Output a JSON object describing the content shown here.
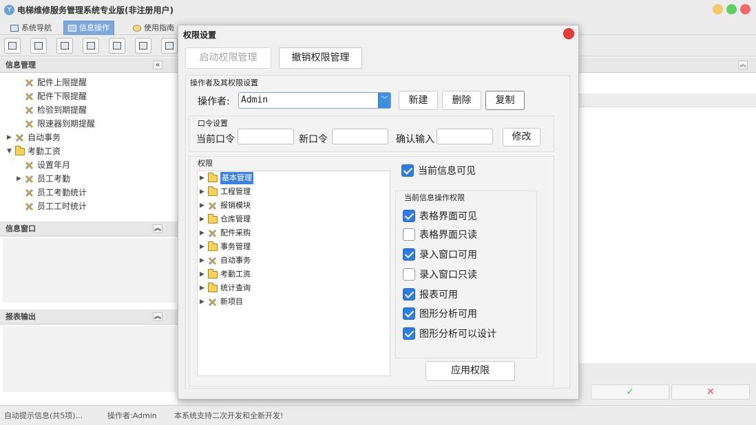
{
  "app": {
    "title": "电梯维修服务管理系统专业版(非注册用户)",
    "tabs": [
      {
        "label": "系统导航",
        "icon": "window-icon"
      },
      {
        "label": "信息操作",
        "icon": "grid-icon"
      },
      {
        "label": "使用指南",
        "icon": "help-icon"
      }
    ],
    "window_buttons": [
      "minimize",
      "maximize",
      "close"
    ]
  },
  "left": {
    "info_header": "信息管理",
    "nav": [
      {
        "label": "配件上限提醒",
        "icon": "tools-icon",
        "expandable": false
      },
      {
        "label": "配件下限提醒",
        "icon": "tools-icon",
        "expandable": false
      },
      {
        "label": "检验到期提醒",
        "icon": "tools-icon",
        "expandable": false
      },
      {
        "label": "限速器到期提醒",
        "icon": "tools-icon",
        "expandable": false
      },
      {
        "label": "自动事务",
        "icon": "tools-icon",
        "expandable": true,
        "expanded": false
      },
      {
        "label": "考勤工资",
        "icon": "folder-icon",
        "expandable": true,
        "expanded": true
      },
      {
        "label": "设置年月",
        "icon": "tools-icon",
        "expandable": false
      },
      {
        "label": "员工考勤",
        "icon": "tools-icon",
        "expandable": true,
        "expanded": false
      },
      {
        "label": "员工考勤统计",
        "icon": "tools-icon",
        "expandable": false
      },
      {
        "label": "员工工时统计",
        "icon": "tools-icon",
        "expandable": false
      }
    ],
    "window_header": "信息窗口",
    "report_header": "报表输出"
  },
  "right": {
    "ok_icon": "check-icon",
    "cancel_icon": "x-icon"
  },
  "status": {
    "hint": "自动提示信息(共5项)...",
    "operator": "操作者:Admin",
    "note": "本系统支持二次开发和全新开发!"
  },
  "dialog": {
    "title": "权限设置",
    "enable_btn": "启动权限管理",
    "revoke_btn": "撤销权限管理",
    "operator_group": "操作者及其权限设置",
    "operator_label": "操作者:",
    "operator_value": "Admin",
    "new_btn": "新建",
    "delete_btn": "删除",
    "copy_btn": "复制",
    "password_group": "口令设置",
    "current_pwd_label": "当前口令",
    "new_pwd_label": "新口令",
    "confirm_pwd_label": "确认输入",
    "modify_btn": "修改",
    "perm_group": "权限",
    "tree": [
      {
        "label": "基本管理",
        "icon": "folder-icon",
        "selected": true
      },
      {
        "label": "工程管理",
        "icon": "folder-icon",
        "selected": false
      },
      {
        "label": "报销模块",
        "icon": "tools-icon",
        "selected": false
      },
      {
        "label": "仓库管理",
        "icon": "folder-icon",
        "selected": false
      },
      {
        "label": "配件采购",
        "icon": "tools-icon",
        "selected": false
      },
      {
        "label": "事务管理",
        "icon": "folder-icon",
        "selected": false
      },
      {
        "label": "自动事务",
        "icon": "tools-icon",
        "selected": false
      },
      {
        "label": "考勤工资",
        "icon": "folder-icon",
        "selected": false
      },
      {
        "label": "统计查询",
        "icon": "folder-icon",
        "selected": false
      },
      {
        "label": "新项目",
        "icon": "tools-icon",
        "selected": false
      }
    ],
    "current_visible": {
      "label": "当前信息可见",
      "checked": true
    },
    "ops_group": "当前信息操作权限",
    "ops": [
      {
        "label": "表格界面可见",
        "checked": true
      },
      {
        "label": "表格界面只读",
        "checked": false
      },
      {
        "label": "录入窗口可用",
        "checked": true
      },
      {
        "label": "录入窗口只读",
        "checked": false
      },
      {
        "label": "报表可用",
        "checked": true
      },
      {
        "label": "图形分析可用",
        "checked": true
      },
      {
        "label": "图形分析可以设计",
        "checked": true
      }
    ],
    "apply_btn": "应用权限"
  }
}
